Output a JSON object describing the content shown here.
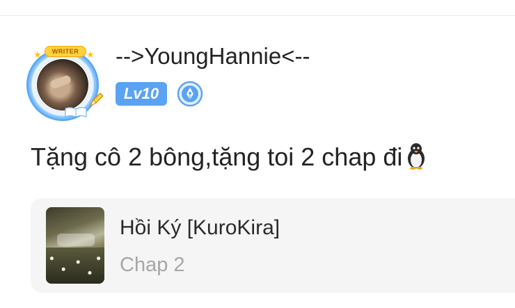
{
  "user": {
    "username": "-->YoungHannie<--",
    "level_label": "Lv10",
    "avatar_badge": "WRITER"
  },
  "comment": {
    "text": "Tặng cô 2 bông,tặng toi 2 chap đi",
    "emoji": "penguin-icon"
  },
  "chapter_card": {
    "story_title": "Hồi Ký [KuroKira]",
    "chapter": "Chap 2"
  },
  "colors": {
    "level_badge_bg": "#5aa3f3",
    "card_bg": "#f5f5f5",
    "chapter_text": "#a6a6a6"
  }
}
